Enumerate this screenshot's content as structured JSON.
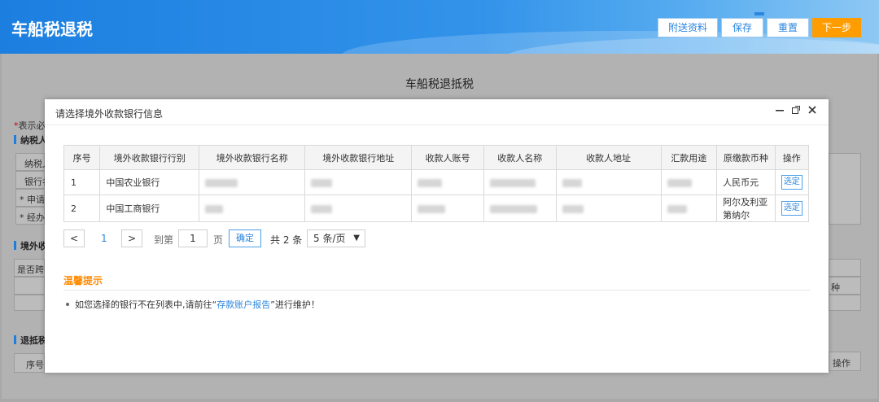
{
  "header": {
    "title": "车船税退税",
    "buttons": {
      "attach": "附送资料",
      "save": "保存",
      "reset": "重置",
      "next": "下一步"
    }
  },
  "background": {
    "page_title": "车船税退抵税",
    "required_hint_star": "*",
    "required_hint": "表示必",
    "section_taxpayer": "纳税人",
    "row_labels": [
      "纳税人",
      "银行名",
      "* 申请",
      "* 经办"
    ],
    "section_overseas": "境外收",
    "is_cross_label": "是否跨",
    "section_refund": "退抵税",
    "seq_label": "序号",
    "right_col1": "种",
    "right_col2": "操作"
  },
  "modal": {
    "title": "请选择境外收款银行信息",
    "icons": {
      "minimize": "minimize-icon",
      "maximize": "maximize-icon",
      "close": "close-icon"
    },
    "table": {
      "headers": [
        "序号",
        "境外收款银行行别",
        "境外收款银行名称",
        "境外收款银行地址",
        "收款人账号",
        "收款人名称",
        "收款人地址",
        "汇款用途",
        "原缴款币种",
        "操作"
      ],
      "rows": [
        {
          "idx": "1",
          "bank_type": "中国农业银行",
          "currency": "人民币元",
          "action": "选定"
        },
        {
          "idx": "2",
          "bank_type": "中国工商银行",
          "currency": "阿尔及利亚第纳尔",
          "action": "选定"
        }
      ]
    },
    "pagination": {
      "prev": "<",
      "current_page": "1",
      "next": ">",
      "goto_prefix": "到第",
      "goto_value": "1",
      "goto_suffix": "页",
      "confirm": "确定",
      "total": "共 2 条",
      "page_size": "5 条/页"
    },
    "tip": {
      "title": "温馨提示",
      "text_before": "如您选择的银行不在列表中,请前往“",
      "link": "存款账户报告",
      "text_after": "”进行维护！"
    }
  }
}
